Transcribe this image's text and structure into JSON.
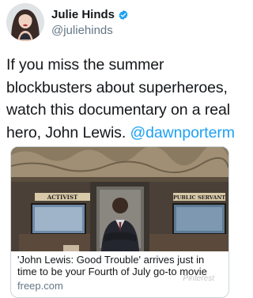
{
  "user": {
    "display_name": "Julie Hinds",
    "handle": "@juliehinds"
  },
  "tweet": {
    "text": "If you miss the summer blockbusters about superheroes, watch this documentary on a real hero, John Lewis.",
    "mention": "@dawnporterm"
  },
  "card": {
    "title": "'John Lewis: Good Trouble' arrives just in time to be your Fourth of July go-to movie",
    "domain": "freep.com",
    "image_signs": {
      "left": "ACTIVIST",
      "right": "PUBLIC SERVANT"
    }
  },
  "watermark": "Pinterest",
  "colors": {
    "accent": "#1da1f2",
    "secondary_text": "#657786",
    "border": "#ccd6dd"
  },
  "icons": {
    "verified": "verified-badge-icon"
  }
}
